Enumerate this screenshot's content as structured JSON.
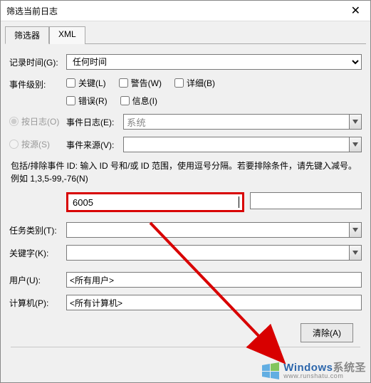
{
  "window": {
    "title": "筛选当前日志"
  },
  "tabs": {
    "filter": "筛选器",
    "xml": "XML"
  },
  "labels": {
    "logged": "记录时间(G):",
    "level": "事件级别:",
    "byLog": "按日志(O)",
    "byLogField": "事件日志(E):",
    "bySource": "按源(S)",
    "bySourceField": "事件来源(V):",
    "taskCat": "任务类别(T):",
    "keywords": "关键字(K):",
    "user": "用户(U):",
    "computer": "计算机(P):"
  },
  "levelChecks": {
    "critical": "关键(L)",
    "warning": "警告(W)",
    "verbose": "详细(B)",
    "error": "错误(R)",
    "info": "信息(I)"
  },
  "values": {
    "loggedSelect": "任何时间",
    "eventLog": "系统",
    "eventSource": "",
    "idInput": "6005",
    "user": "<所有用户>",
    "computer": "<所有计算机>"
  },
  "helpText": "包括/排除事件 ID: 输入 ID 号和/或 ID 范围，使用逗号分隔。若要排除条件，请先键入减号。例如 1,3,5-99,-76(N)",
  "buttons": {
    "clear": "清除(A)"
  },
  "watermark": {
    "main1": "W",
    "main2": "indows",
    "main3": "系统圣",
    "sub": "www.runshatu.com"
  }
}
